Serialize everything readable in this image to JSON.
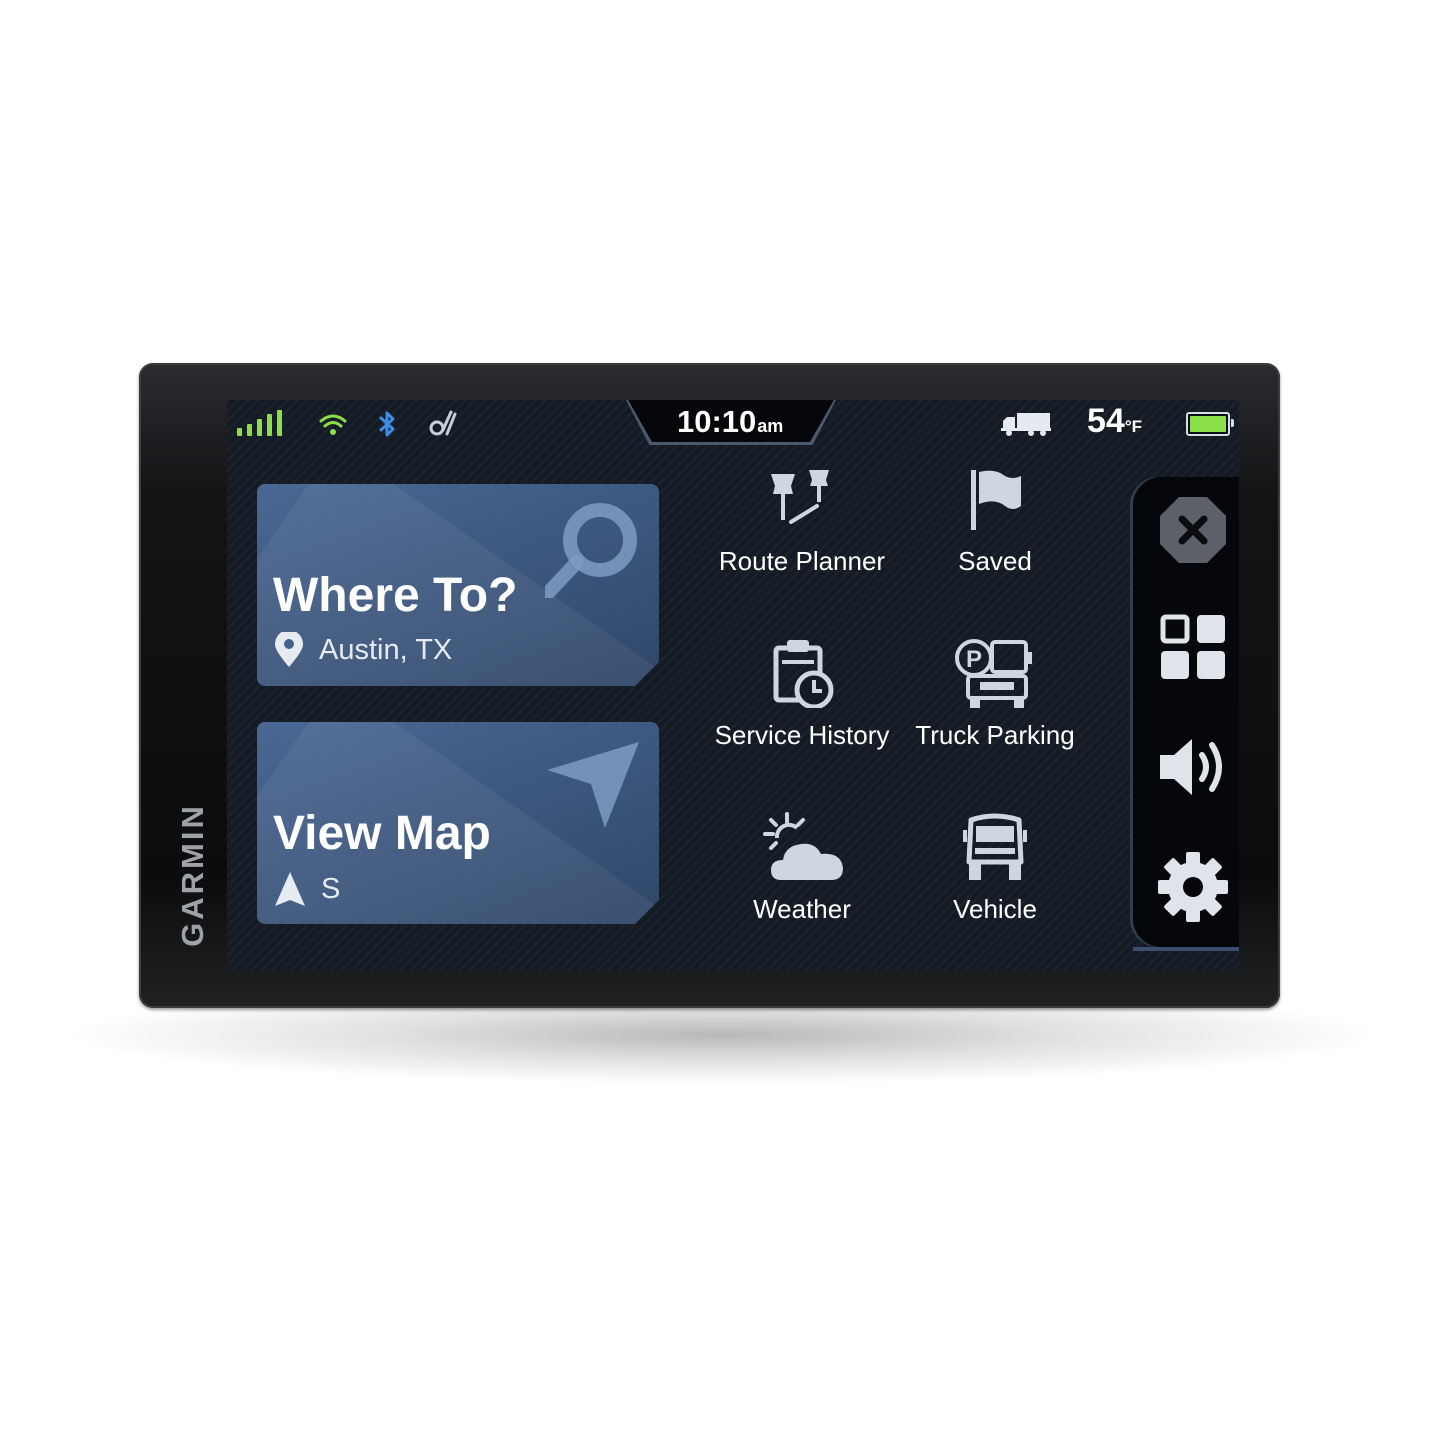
{
  "device": {
    "brand": "GARMIN"
  },
  "status_bar": {
    "time": "10:10",
    "time_suffix": "am",
    "temperature": "54",
    "temperature_unit": "°F",
    "battery_level": 1.0,
    "icons": [
      "cell-signal-icon",
      "wifi-icon",
      "bluetooth-icon",
      "garmin-drive-icon",
      "truck-icon",
      "battery-icon"
    ],
    "colors": {
      "signal": "#8be04a",
      "wifi": "#8be04a",
      "bluetooth": "#3b8fe8",
      "battery": "#8be04a"
    }
  },
  "tiles": [
    {
      "title": "Where To?",
      "subtitle": "Austin, TX",
      "icon": "search-icon",
      "sub_icon": "location-pin-icon"
    },
    {
      "title": "View Map",
      "subtitle": "S",
      "icon": "navigation-arrow-icon",
      "sub_icon": "heading-arrow-icon"
    }
  ],
  "menu": [
    {
      "label": "Route Planner",
      "icon": "route-planner-icon"
    },
    {
      "label": "Saved",
      "icon": "flag-icon"
    },
    {
      "label": "Service History",
      "icon": "service-history-icon"
    },
    {
      "label": "Truck Parking",
      "icon": "truck-parking-icon"
    },
    {
      "label": "Weather",
      "icon": "weather-icon"
    },
    {
      "label": "Vehicle",
      "icon": "vehicle-icon"
    }
  ],
  "side_panel": {
    "buttons": [
      "close-icon",
      "apps-grid-icon",
      "volume-icon",
      "settings-icon"
    ]
  }
}
